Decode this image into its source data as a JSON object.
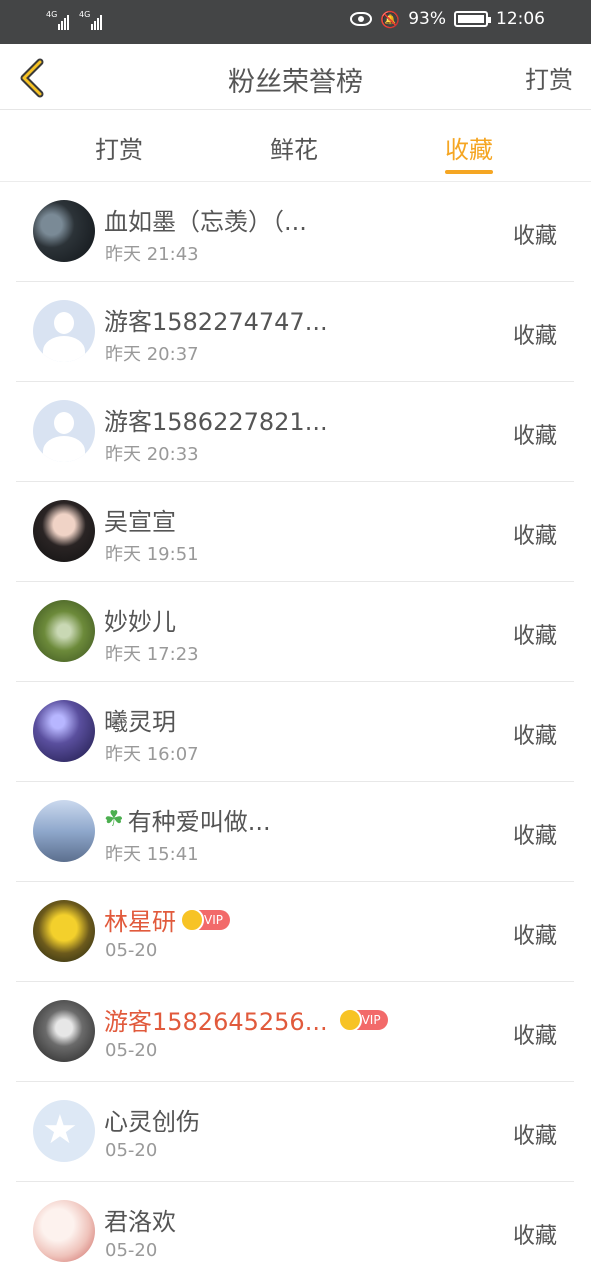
{
  "status_bar": {
    "network1": "4G",
    "network2": "4G",
    "battery": "93%",
    "time": "12:06"
  },
  "header": {
    "title": "粉丝荣誉榜",
    "action": "打赏"
  },
  "tabs": [
    {
      "label": "打赏",
      "active": false
    },
    {
      "label": "鲜花",
      "active": false
    },
    {
      "label": "收藏",
      "active": true
    }
  ],
  "accent_color": "#f5a623",
  "vip_name_color": "#e15a3c",
  "vip_label": "VIP",
  "rows": [
    {
      "name": "血如墨（忘羡）（...",
      "time": "昨天 21:43",
      "action": "收藏",
      "avatar": "dark-photo",
      "vip": false
    },
    {
      "name": "游客1582274747...",
      "time": "昨天 20:37",
      "action": "收藏",
      "avatar": "default-avatar",
      "vip": false
    },
    {
      "name": "游客1586227821...",
      "time": "昨天 20:33",
      "action": "收藏",
      "avatar": "default-avatar",
      "vip": false
    },
    {
      "name": "吴宣宣",
      "time": "昨天 19:51",
      "action": "收藏",
      "avatar": "girl-photo",
      "vip": false
    },
    {
      "name": "妙妙儿",
      "time": "昨天 17:23",
      "action": "收藏",
      "avatar": "field-photo",
      "vip": false
    },
    {
      "name": "曦灵玥",
      "time": "昨天 16:07",
      "action": "收藏",
      "avatar": "stars-photo",
      "vip": false
    },
    {
      "name": "有种爱叫做...",
      "time": "昨天 15:41",
      "action": "收藏",
      "avatar": "sea-photo",
      "vip": false,
      "prefix_icon": "clover-icon"
    },
    {
      "name": "林星研",
      "time": "05-20",
      "action": "收藏",
      "avatar": "flower-photo",
      "vip": true
    },
    {
      "name": "游客1582645256...",
      "time": "05-20",
      "action": "收藏",
      "avatar": "bw-photo",
      "vip": true
    },
    {
      "name": "心灵创伤",
      "time": "05-20",
      "action": "收藏",
      "avatar": "qq-avatar",
      "vip": false
    },
    {
      "name": "君洛欢",
      "time": "05-20",
      "action": "收藏",
      "avatar": "painting-photo",
      "vip": false
    }
  ]
}
